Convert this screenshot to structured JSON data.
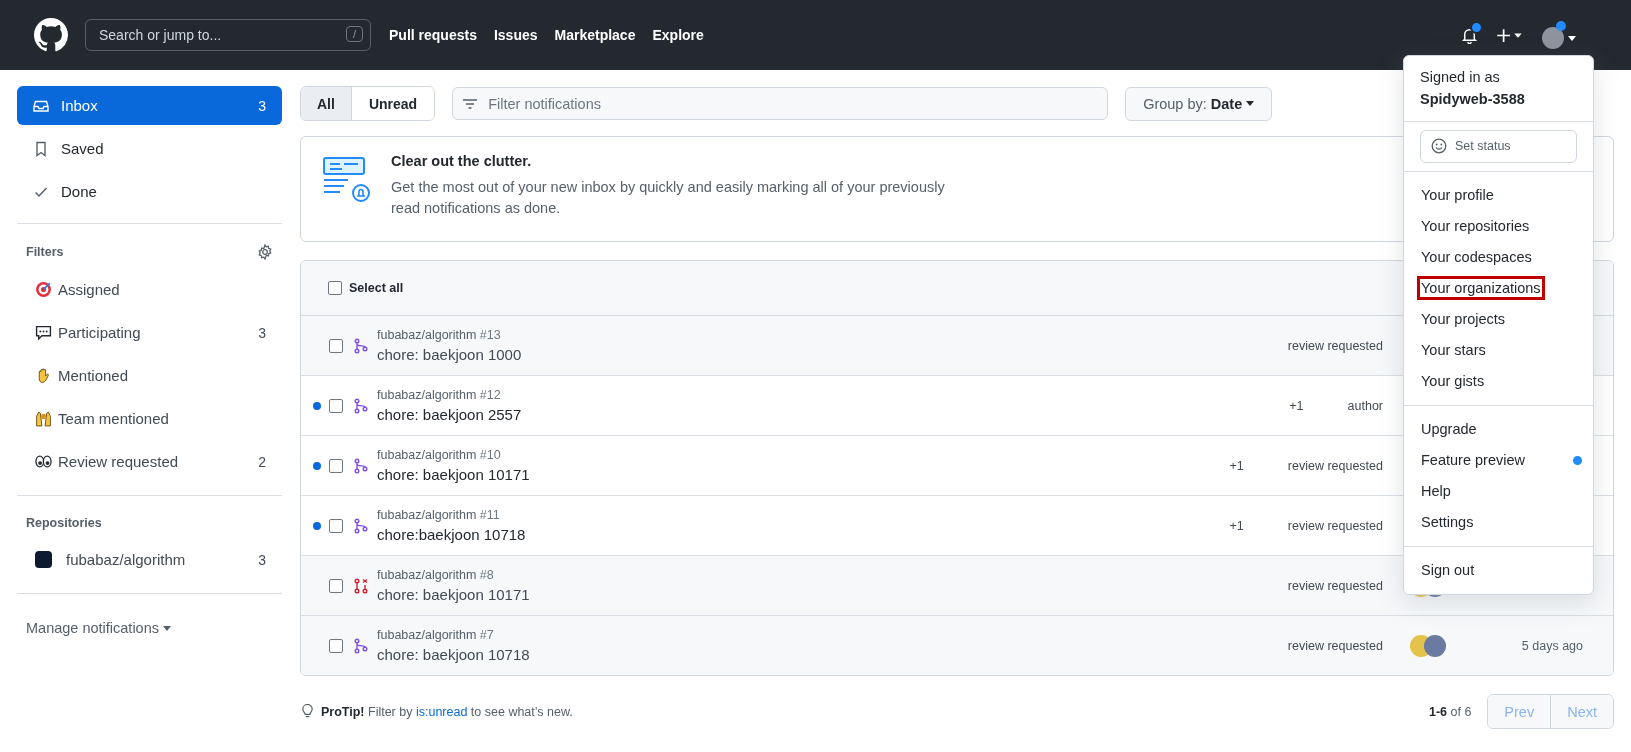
{
  "header": {
    "search_placeholder": "Search or jump to...",
    "search_key": "/",
    "nav": [
      "Pull requests",
      "Issues",
      "Marketplace",
      "Explore"
    ],
    "notification_unread": true
  },
  "sidebar": {
    "items": [
      {
        "label": "Inbox",
        "count": "3",
        "selected": true
      },
      {
        "label": "Saved",
        "selected": false
      },
      {
        "label": "Done",
        "selected": false
      }
    ],
    "filters_title": "Filters",
    "filters": [
      {
        "label": "Assigned"
      },
      {
        "label": "Participating",
        "count": "3"
      },
      {
        "label": "Mentioned"
      },
      {
        "label": "Team mentioned"
      },
      {
        "label": "Review requested",
        "count": "2"
      }
    ],
    "repositories_title": "Repositories",
    "repositories": [
      {
        "label": "fubabaz/algorithm",
        "count": "3"
      }
    ],
    "manage": "Manage notifications"
  },
  "toolbar": {
    "tabs": [
      {
        "label": "All",
        "selected": true
      },
      {
        "label": "Unread",
        "selected": false
      }
    ],
    "filter_placeholder": "Filter notifications",
    "group_by_label": "Group by:",
    "group_by_value": "Date"
  },
  "banner": {
    "title": "Clear out the clutter.",
    "text": "Get the most out of your new inbox by quickly and easily marking all of your previously read notifications as done."
  },
  "list": {
    "select_all": "Select all",
    "select_all_checked": false,
    "rows": [
      {
        "kind": "pr_open",
        "unread": false,
        "checked": false,
        "repo": "fubabaz/algorithm",
        "number": "#13",
        "title": "chore: baekjoon 1000",
        "reason": "review requested"
      },
      {
        "kind": "pr_open",
        "unread": true,
        "checked": false,
        "repo": "fubabaz/algorithm",
        "number": "#12",
        "title": "chore: baekjoon 2557",
        "extra": "+1",
        "reason": "author"
      },
      {
        "kind": "pr_open",
        "unread": true,
        "checked": false,
        "repo": "fubabaz/algorithm",
        "number": "#10",
        "title": "chore: baekjoon 10171",
        "extra": "+1",
        "reason": "review requested"
      },
      {
        "kind": "pr_open",
        "unread": true,
        "checked": false,
        "repo": "fubabaz/algorithm",
        "number": "#11",
        "title": "chore:baekjoon 10718",
        "extra": "+1",
        "reason": "review requested"
      },
      {
        "kind": "pr_closed",
        "unread": false,
        "checked": false,
        "repo": "fubabaz/algorithm",
        "number": "#8",
        "title": "chore: baekjoon 10171",
        "reason": "review requested",
        "avatars": true
      },
      {
        "kind": "pr_open",
        "unread": false,
        "checked": false,
        "repo": "fubabaz/algorithm",
        "number": "#7",
        "title": "chore: baekjoon 10718",
        "reason": "review requested",
        "avatars": true,
        "time": "5 days ago"
      }
    ]
  },
  "footer": {
    "tip": "**ProTip!** Filter by",
    "tip_link": "is:unread",
    "tip_end": "to see what’s new.",
    "range": "**1-6** of 6",
    "prev": "Prev",
    "next": "Next"
  },
  "menu": {
    "signed_in_as": "Signed in as",
    "user": "Spidyweb-3588",
    "set_status": "Set status",
    "groups": [
      [
        {
          "label": "Your profile",
          "highlighted": false
        },
        {
          "label": "Your repositories",
          "highlighted": false
        },
        {
          "label": "Your codespaces",
          "highlighted": false
        },
        {
          "label": "Your organizations",
          "highlighted": true
        },
        {
          "label": "Your projects",
          "highlighted": false
        },
        {
          "label": "Your stars",
          "highlighted": false
        },
        {
          "label": "Your gists",
          "highlighted": false
        }
      ],
      [
        {
          "label": "Upgrade",
          "highlighted": false,
          "new": false
        },
        {
          "label": "Feature preview",
          "highlighted": false,
          "new": true
        },
        {
          "label": "Help",
          "highlighted": false,
          "new": false
        },
        {
          "label": "Settings",
          "highlighted": false,
          "new": false
        }
      ],
      [
        {
          "label": "Sign out",
          "highlighted": false
        }
      ]
    ]
  }
}
